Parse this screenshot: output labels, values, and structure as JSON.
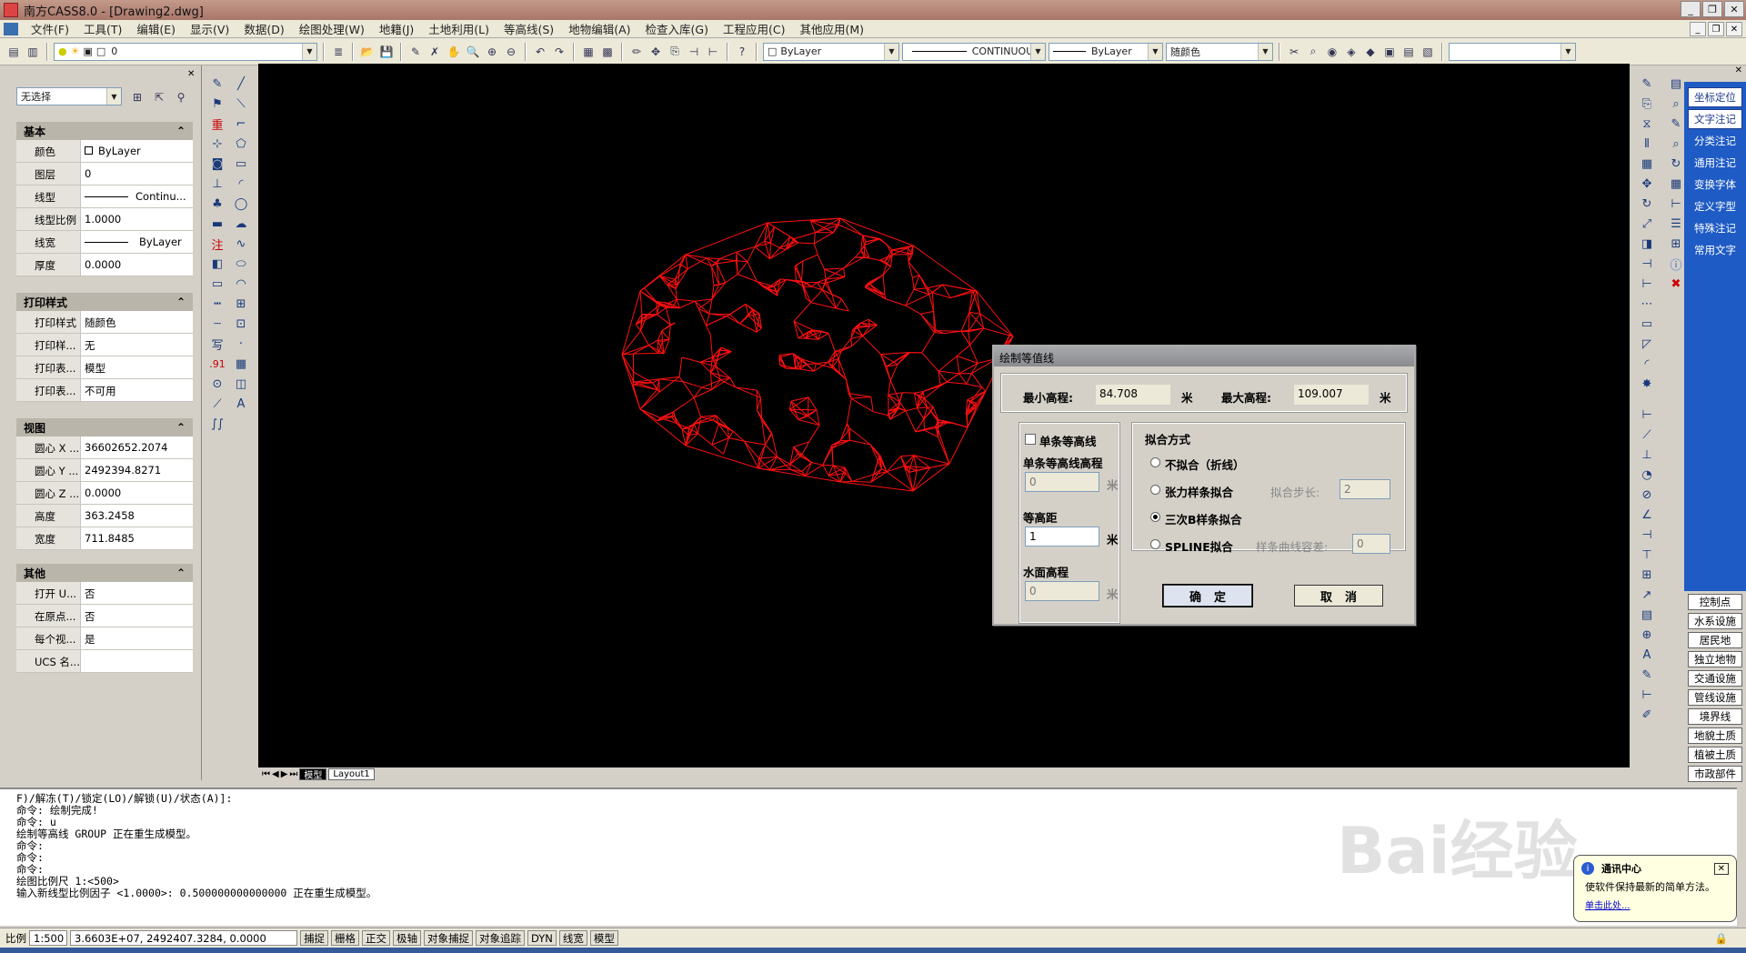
{
  "window": {
    "title": "南方CASS8.0 - [Drawing2.dwg]"
  },
  "menu": [
    "文件(F)",
    "工具(T)",
    "编辑(E)",
    "显示(V)",
    "数据(D)",
    "绘图处理(W)",
    "地籍(J)",
    "土地利用(L)",
    "等高线(S)",
    "地物编辑(A)",
    "检查入库(G)",
    "工程应用(C)",
    "其他应用(M)"
  ],
  "toolbar": {
    "layer_value": "0",
    "color_value": "ByLayer",
    "linetype_value": "CONTINUOUS",
    "lineweight_value": "ByLayer",
    "plotstyle_value": "随颜色"
  },
  "properties": {
    "selection": "无选择",
    "sections": [
      {
        "title": "基本",
        "rows": [
          [
            "颜色",
            "ByLayer"
          ],
          [
            "图层",
            "0"
          ],
          [
            "线型",
            "Continu..."
          ],
          [
            "线型比例",
            "1.0000"
          ],
          [
            "线宽",
            "ByLayer"
          ],
          [
            "厚度",
            "0.0000"
          ]
        ]
      },
      {
        "title": "打印样式",
        "rows": [
          [
            "打印样式",
            "随颜色"
          ],
          [
            "打印样...",
            "无"
          ],
          [
            "打印表...",
            "模型"
          ],
          [
            "打印表...",
            "不可用"
          ]
        ]
      },
      {
        "title": "视图",
        "rows": [
          [
            "圆心 X ...",
            "36602652.2074"
          ],
          [
            "圆心 Y ...",
            "2492394.8271"
          ],
          [
            "圆心 Z ...",
            "0.0000"
          ],
          [
            "高度",
            "363.2458"
          ],
          [
            "宽度",
            "711.8485"
          ]
        ]
      },
      {
        "title": "其他",
        "rows": [
          [
            "打开 U...",
            "否"
          ],
          [
            "在原点...",
            "否"
          ],
          [
            "每个视...",
            "是"
          ],
          [
            "UCS 名...",
            ""
          ]
        ]
      }
    ]
  },
  "layout_tabs": [
    "模型",
    "Layout1"
  ],
  "dialog": {
    "title": "绘制等值线",
    "min_label": "最小高程:",
    "min_value": "84.708",
    "max_label": "最大高程:",
    "max_value": "109.007",
    "unit": "米",
    "single_contour_check": "单条等高线",
    "single_height_label": "单条等高线高程",
    "single_height_value": "0",
    "interval_label": "等高距",
    "interval_value": "1",
    "water_label": "水面高程",
    "water_value": "0",
    "fit_group": "拟合方式",
    "options": [
      "不拟合（折线）",
      "张力样条拟合",
      "三次B样条拟合",
      "SPLINE拟合"
    ],
    "selected_option": 2,
    "step_label": "拟合步长:",
    "step_value": "2",
    "tolerance_label": "样条曲线容差:",
    "tolerance_value": "0",
    "ok": "确定",
    "cancel": "取消"
  },
  "cass_panel": {
    "top": [
      "坐标定位",
      "文字注记",
      "分类注记",
      "通用注记",
      "变换字体",
      "定义字型",
      "特殊注记",
      "常用文字"
    ],
    "bottom": [
      "控制点",
      "水系设施",
      "居民地",
      "独立地物",
      "交通设施",
      "管线设施",
      "境界线",
      "地貌土质",
      "植被土质",
      "市政部件"
    ]
  },
  "command_lines": [
    "F)/解冻(T)/锁定(LO)/解锁(U)/状态(A)]:",
    "命令: 绘制完成!",
    "命令: u",
    "绘制等高线 GROUP 正在重生成模型。",
    "命令:",
    "命令:",
    "命令:",
    "绘图比例尺 1:<500>",
    "输入新线型比例因子 <1.0000>: 0.500000000000000 正在重生成模型。"
  ],
  "status": {
    "scale_label": "比例",
    "scale_value": "1:500",
    "coords": "3.6603E+07, 2492407.3284, 0.0000",
    "toggles": [
      "捕捉",
      "栅格",
      "正交",
      "极轴",
      "对象捕捉",
      "对象追踪",
      "DYN",
      "线宽",
      "模型"
    ]
  },
  "notification": {
    "title": "通讯中心",
    "body": "使软件保持最新的简单方法。",
    "link": "单击此处..."
  },
  "watermark": "Bai经验"
}
